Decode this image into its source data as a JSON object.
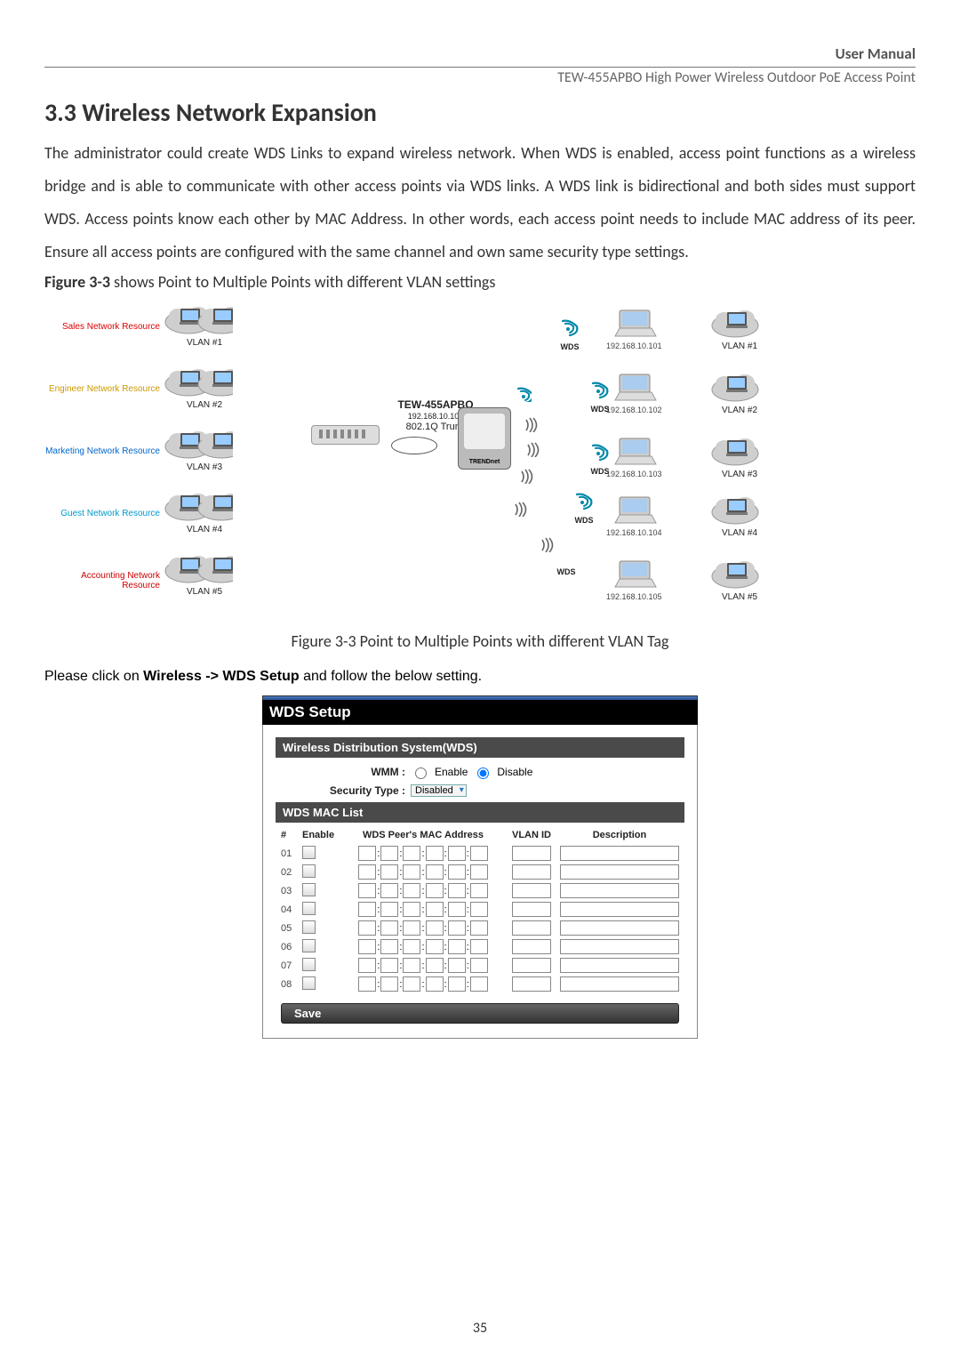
{
  "header": {
    "right": "User Manual",
    "sub": "TEW-455APBO High Power Wireless Outdoor PoE Access Point"
  },
  "section": {
    "title": "3.3 Wireless Network Expansion",
    "body": "The administrator could create WDS Links to expand wireless network. When WDS is enabled, access point functions as a wireless bridge and is able to communicate with other access points via WDS links. A WDS link is bidirectional and both sides must support WDS. Access points know each other by MAC Address. In other words, each access point needs to include MAC address of its peer. Ensure all access points are configured with the same channel and own same security type settings.",
    "fig_ref_prefix": "Figure 3-3",
    "fig_ref_rest": " shows Point to Multiple Points with different VLAN settings"
  },
  "diagram": {
    "resources": [
      {
        "label": "Sales Network Resource",
        "vlan": "VLAN #1",
        "colorClass": "c-sales"
      },
      {
        "label": "Engineer Network Resource",
        "vlan": "VLAN #2",
        "colorClass": "c-eng"
      },
      {
        "label": "Marketing Network Resource",
        "vlan": "VLAN #3",
        "colorClass": "c-mkt"
      },
      {
        "label": "Guest Network Resource",
        "vlan": "VLAN #4",
        "colorClass": "c-guest"
      },
      {
        "label": "Accounting Network Resource",
        "vlan": "VLAN #5",
        "colorClass": "c-acct"
      }
    ],
    "center": {
      "name": "TEW-455APBO",
      "ip": "192.168.10.100",
      "trunk": "802.1Q Trunk",
      "brand": "TRENDnet"
    },
    "wds_global_label": "WDS",
    "wds": [
      {
        "ip": "192.168.10.101",
        "vlan": "VLAN #1"
      },
      {
        "ip": "192.168.10.102",
        "vlan": "VLAN #2"
      },
      {
        "ip": "192.168.10.103",
        "vlan": "VLAN #3"
      },
      {
        "ip": "192.168.10.104",
        "vlan": "VLAN #4"
      },
      {
        "ip": "192.168.10.105",
        "vlan": "VLAN #5"
      }
    ],
    "caption": "Figure 3-3 Point to Multiple Points with different VLAN Tag"
  },
  "instruction": {
    "pre": "Please click on ",
    "bold": "Wireless -> WDS Setup",
    "post": " and follow the below setting."
  },
  "panel": {
    "title": "WDS Setup",
    "section1": "Wireless Distribution System(WDS)",
    "wmm_label": "WMM :",
    "wmm_enable": "Enable",
    "wmm_disable": "Disable",
    "sec_label": "Security Type :",
    "sec_value": "Disabled",
    "section2": "WDS MAC List",
    "cols": {
      "num": "#",
      "enable": "Enable",
      "mac": "WDS Peer's MAC Address",
      "vlan": "VLAN ID",
      "desc": "Description"
    },
    "rows": [
      "01",
      "02",
      "03",
      "04",
      "05",
      "06",
      "07",
      "08"
    ],
    "save": "Save"
  },
  "page_number": "35"
}
